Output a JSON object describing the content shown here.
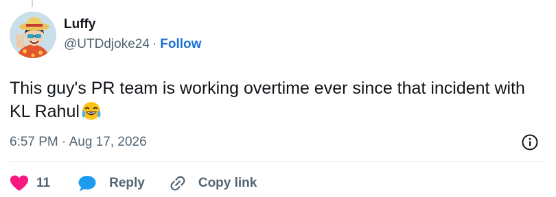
{
  "author": {
    "display_name": "Luffy",
    "handle": "@UTDdjoke24",
    "separator": "·",
    "follow_label": "Follow"
  },
  "tweet": {
    "text": "This guy's PR team is working overtime ever since that incident with KL Rahul",
    "emoji": "face-with-tears-of-joy",
    "timestamp": "6:57 PM · Aug 17, 2026"
  },
  "actions": {
    "like_count": "11",
    "reply_label": "Reply",
    "copy_label": "Copy link"
  },
  "colors": {
    "like": "#f91880",
    "reply": "#1d9bf0",
    "follow": "#1d70d6",
    "secondary_text": "#536471",
    "primary_text": "#0f1419"
  },
  "icons": [
    "heart-icon",
    "speech-bubble-icon",
    "link-icon",
    "info-icon"
  ]
}
